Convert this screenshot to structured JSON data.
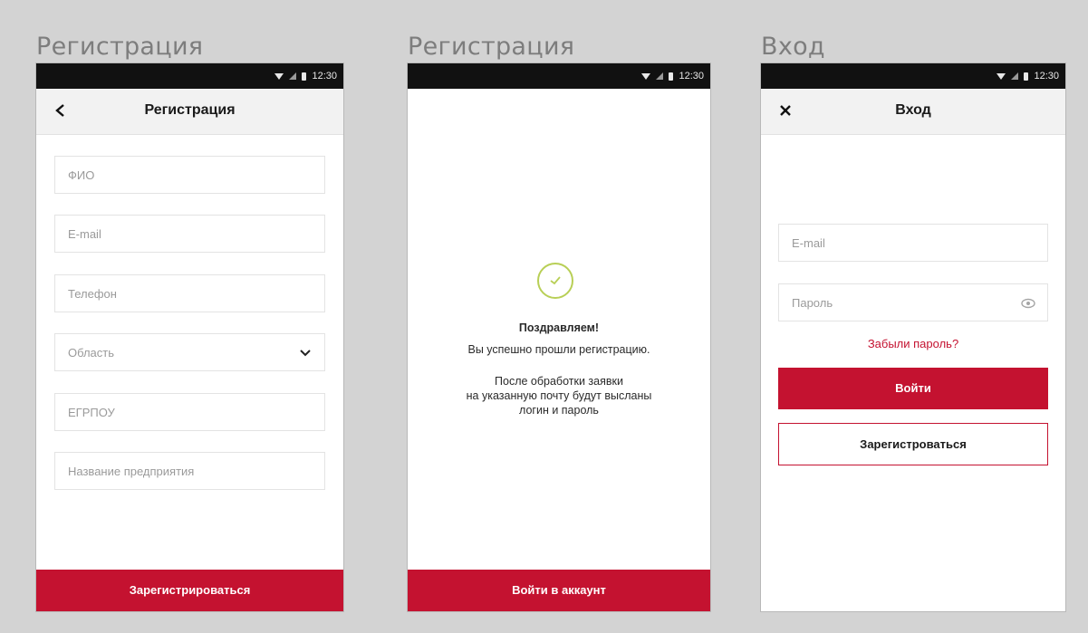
{
  "screens": {
    "registration": {
      "caption": "Регистрация",
      "status": {
        "time": "12:30"
      },
      "appbar": {
        "title": "Регистрация",
        "back_icon": "chevron-left-icon"
      },
      "fields": {
        "fio": "ФИО",
        "email": "E-mail",
        "phone": "Телефон",
        "region": "Область",
        "egrpou": "ЕГРПОУ",
        "company": "Название предприятия"
      },
      "submit_label": "Зарегистрироваться"
    },
    "success": {
      "caption": "Регистрация",
      "status": {
        "time": "12:30"
      },
      "icon": "checkmark-circle-icon",
      "heading": "Поздравляем!",
      "line1": "Вы успешно прошли регистрацию.",
      "line2": "После обработки заявки",
      "line3": "на указанную почту будут высланы",
      "line4": "логин и пароль",
      "button_label": "Войти в аккаунт"
    },
    "login": {
      "caption": "Вход",
      "status": {
        "time": "12:30"
      },
      "appbar": {
        "title": "Вход",
        "close_icon": "close-icon"
      },
      "fields": {
        "email": "E-mail",
        "password": "Пароль"
      },
      "forgot_label": "Забыли пароль?",
      "login_label": "Войти",
      "register_label": "Зарегистроваться"
    }
  },
  "colors": {
    "accent": "#c41230",
    "success": "#b8cf56",
    "background": "#d3d3d3",
    "statusbar": "#111111"
  }
}
